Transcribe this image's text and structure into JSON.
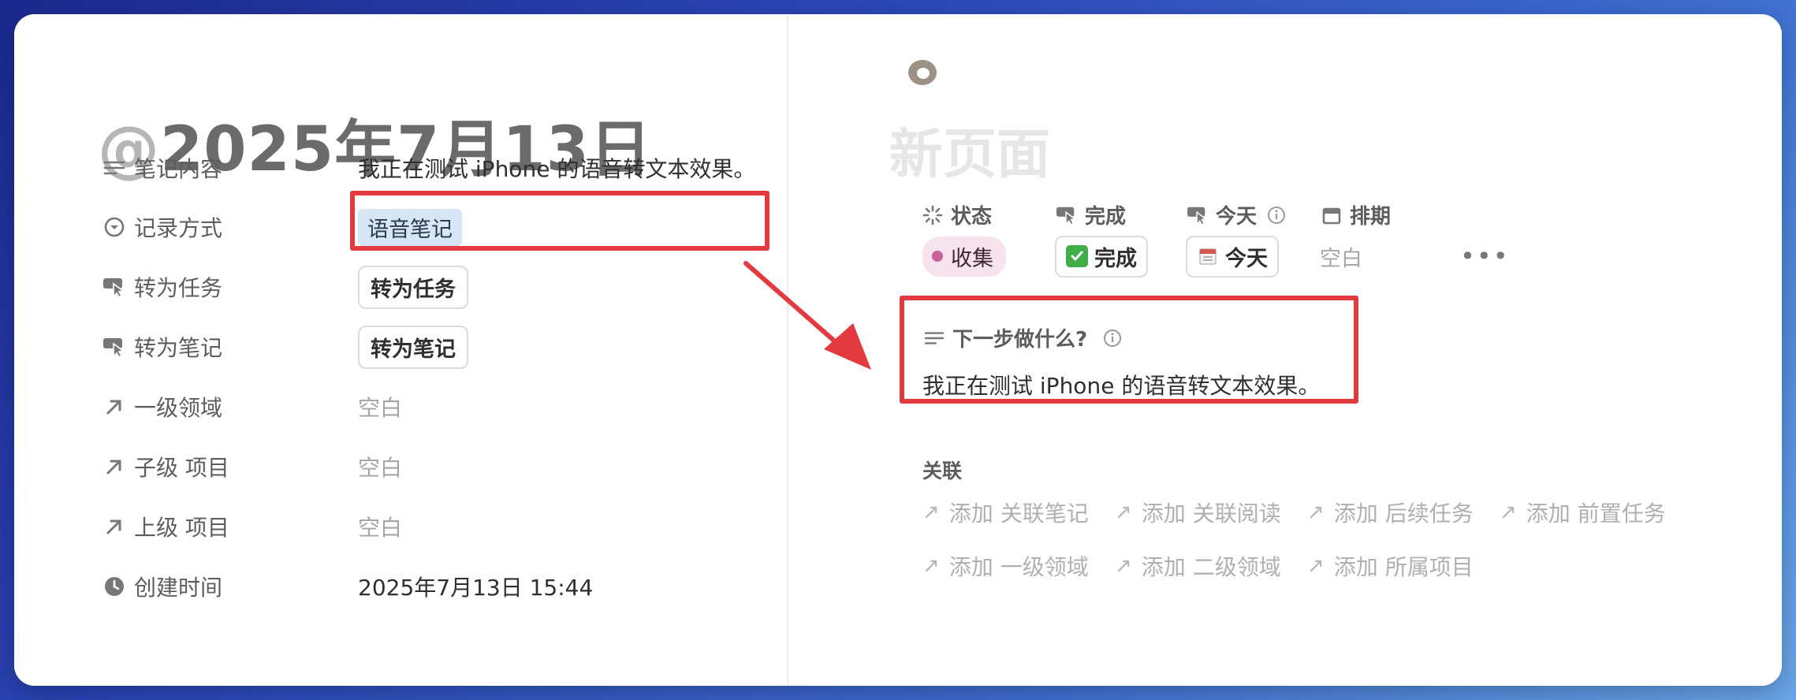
{
  "left": {
    "title_at": "@",
    "title_date": "2025年7月13日",
    "properties": [
      {
        "label": "笔记内容",
        "value": "我正在测试 iPhone 的语音转文本效果。"
      },
      {
        "label": "记录方式",
        "value": "语音笔记"
      },
      {
        "label": "转为任务",
        "value": "转为任务"
      },
      {
        "label": "转为笔记",
        "value": "转为笔记"
      },
      {
        "label": "一级领域",
        "value": "空白"
      },
      {
        "label": "子级 项目",
        "value": "空白"
      },
      {
        "label": "上级 项目",
        "value": "空白"
      },
      {
        "label": "创建时间",
        "value": "2025年7月13日 15:44"
      }
    ]
  },
  "right": {
    "page_title": "新页面",
    "props": [
      {
        "label": "状态",
        "value": "收集"
      },
      {
        "label": "完成",
        "value": "完成"
      },
      {
        "label": "今天",
        "value": "今天"
      },
      {
        "label": "排期",
        "value": "空白"
      }
    ],
    "next_step": {
      "label": "下一步做什么?",
      "body": "我正在测试 iPhone 的语音转文本效果。"
    },
    "relations": {
      "title": "关联",
      "items": [
        "添加 关联笔记",
        "添加 关联阅读",
        "添加 后续任务",
        "添加 前置任务",
        "添加 一级领域",
        "添加 二级领域",
        "添加 所属项目"
      ]
    }
  },
  "colors": {
    "highlight": "#e23a3e",
    "status_dot": "#c7609b",
    "tag_blue": "#d8e5f4"
  }
}
